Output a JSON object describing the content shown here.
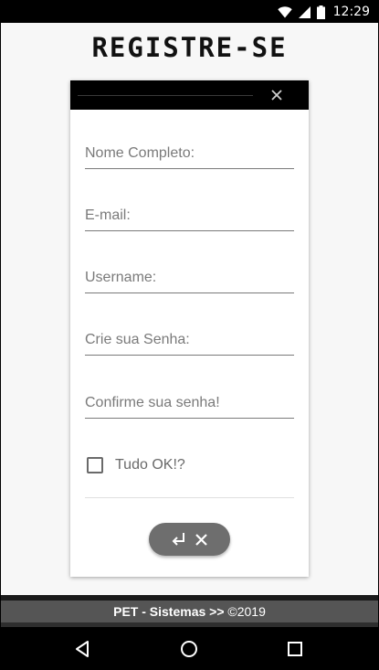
{
  "status_bar": {
    "time": "12:29",
    "icons": [
      "wifi-icon",
      "cell-signal-icon",
      "battery-icon"
    ]
  },
  "page": {
    "title": "REGISTRE-SE"
  },
  "form": {
    "close_icon": "close-icon",
    "fields": [
      {
        "label": "Nome Completo:"
      },
      {
        "label": "E-mail:"
      },
      {
        "label": "Username:"
      },
      {
        "label": "Crie sua Senha:"
      },
      {
        "label": "Confirme sua senha!"
      }
    ],
    "checkbox_label": "Tudo OK!?",
    "checkbox_checked": false,
    "submit_icons": [
      "enter-icon",
      "close-icon"
    ]
  },
  "footer": {
    "brand": "PET - Sistemas >>",
    "copyright": "©2019"
  },
  "nav": {
    "icons": [
      "back-icon",
      "home-icon",
      "recents-icon"
    ]
  },
  "colors": {
    "header_bg": "#000000",
    "page_bg": "#f7f7f7",
    "button_bg": "#6e6e6e",
    "footer_band": "#555555"
  }
}
